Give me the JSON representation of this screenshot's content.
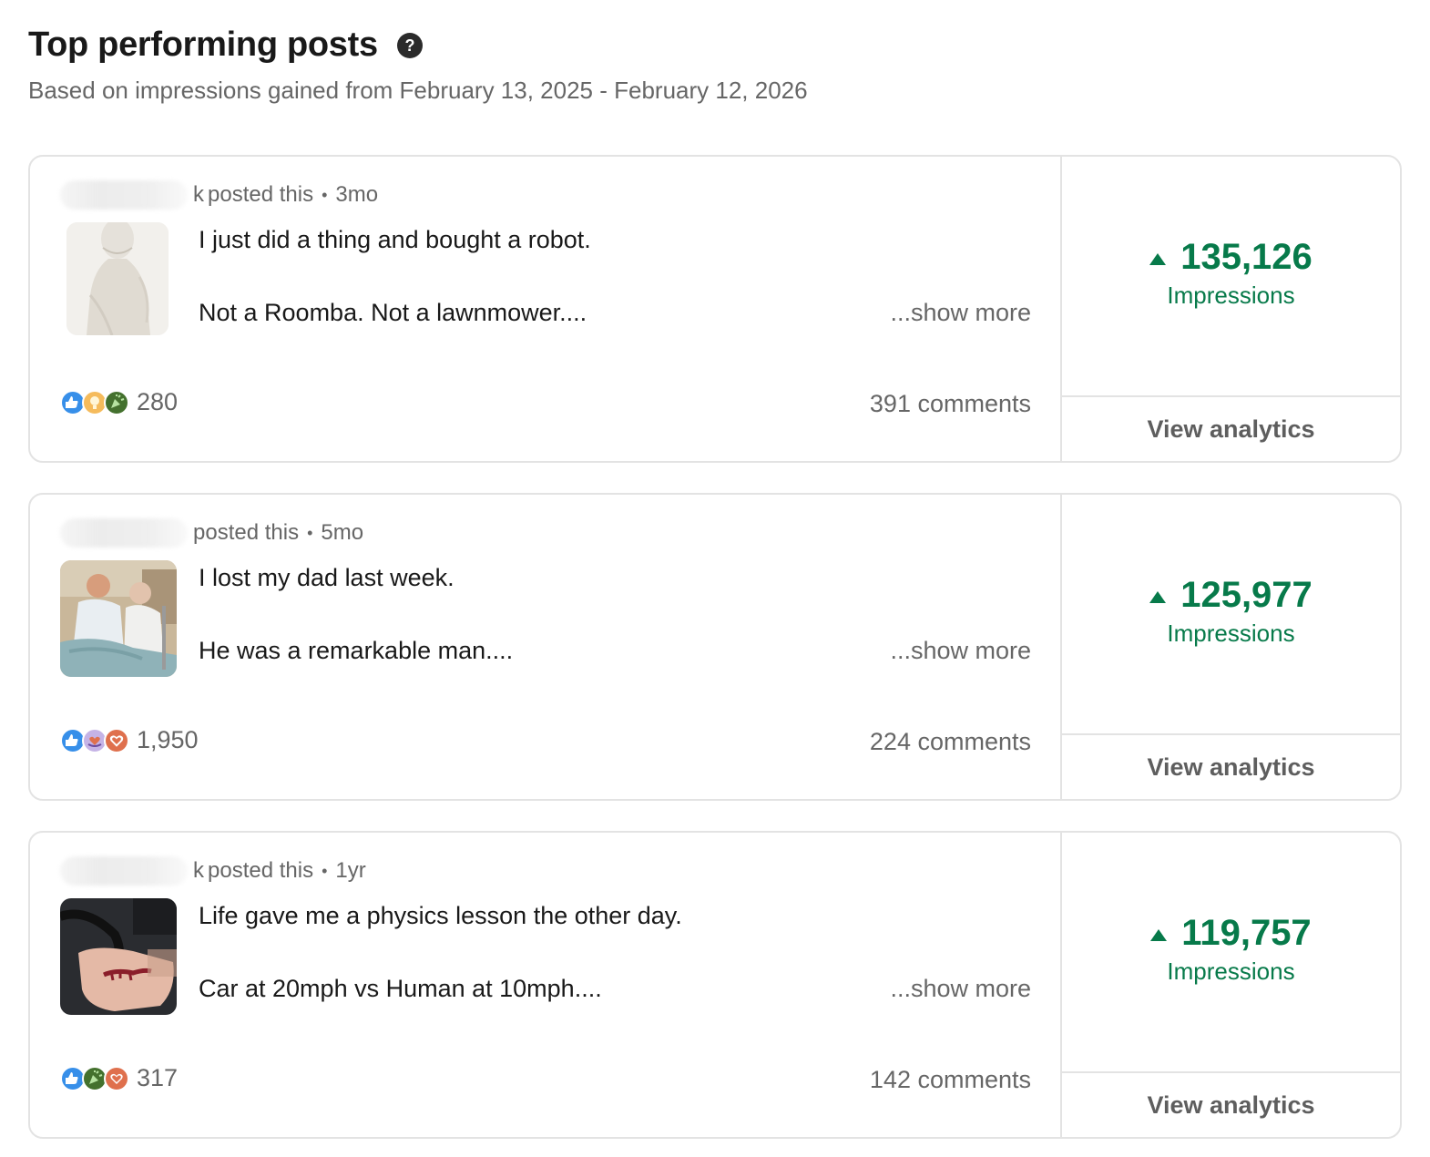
{
  "header": {
    "title": "Top performing posts",
    "subtitle": "Based on impressions gained from February 13, 2025 - February 12, 2026"
  },
  "colors": {
    "impressions_green": "#077a4a",
    "muted_text": "#666666",
    "border": "#e3e3e3"
  },
  "posts": [
    {
      "author_suffix": "k",
      "posted_label": "posted this",
      "age": "3mo",
      "thumbnail": "robot-image",
      "line1": "I just did a thing and bought a robot.",
      "line2": "Not a Roomba. Not a lawnmower....",
      "show_more": "...show more",
      "reaction_icons": [
        "like-icon",
        "insightful-icon",
        "celebrate-icon"
      ],
      "reactions": "280",
      "comments": "391 comments",
      "impressions": "135,126",
      "impressions_label": "Impressions",
      "analytics_label": "View analytics"
    },
    {
      "author_suffix": "",
      "posted_label": "posted this",
      "age": "5mo",
      "thumbnail": "hospital-photo",
      "line1": "I lost my dad last week.",
      "line2": "He was a remarkable man....",
      "show_more": "...show more",
      "reaction_icons": [
        "like-icon",
        "support-icon",
        "love-icon"
      ],
      "reactions": "1,950",
      "comments": "224 comments",
      "impressions": "125,977",
      "impressions_label": "Impressions",
      "analytics_label": "View analytics"
    },
    {
      "author_suffix": "k",
      "posted_label": "posted this",
      "age": "1yr",
      "thumbnail": "injured-hand-photo",
      "line1": "Life gave me a physics lesson the other day.",
      "line2": "Car at 20mph vs Human at 10mph....",
      "show_more": "...show more",
      "reaction_icons": [
        "like-icon",
        "celebrate-icon",
        "love-icon"
      ],
      "reactions": "317",
      "comments": "142 comments",
      "impressions": "119,757",
      "impressions_label": "Impressions",
      "analytics_label": "View analytics"
    }
  ]
}
